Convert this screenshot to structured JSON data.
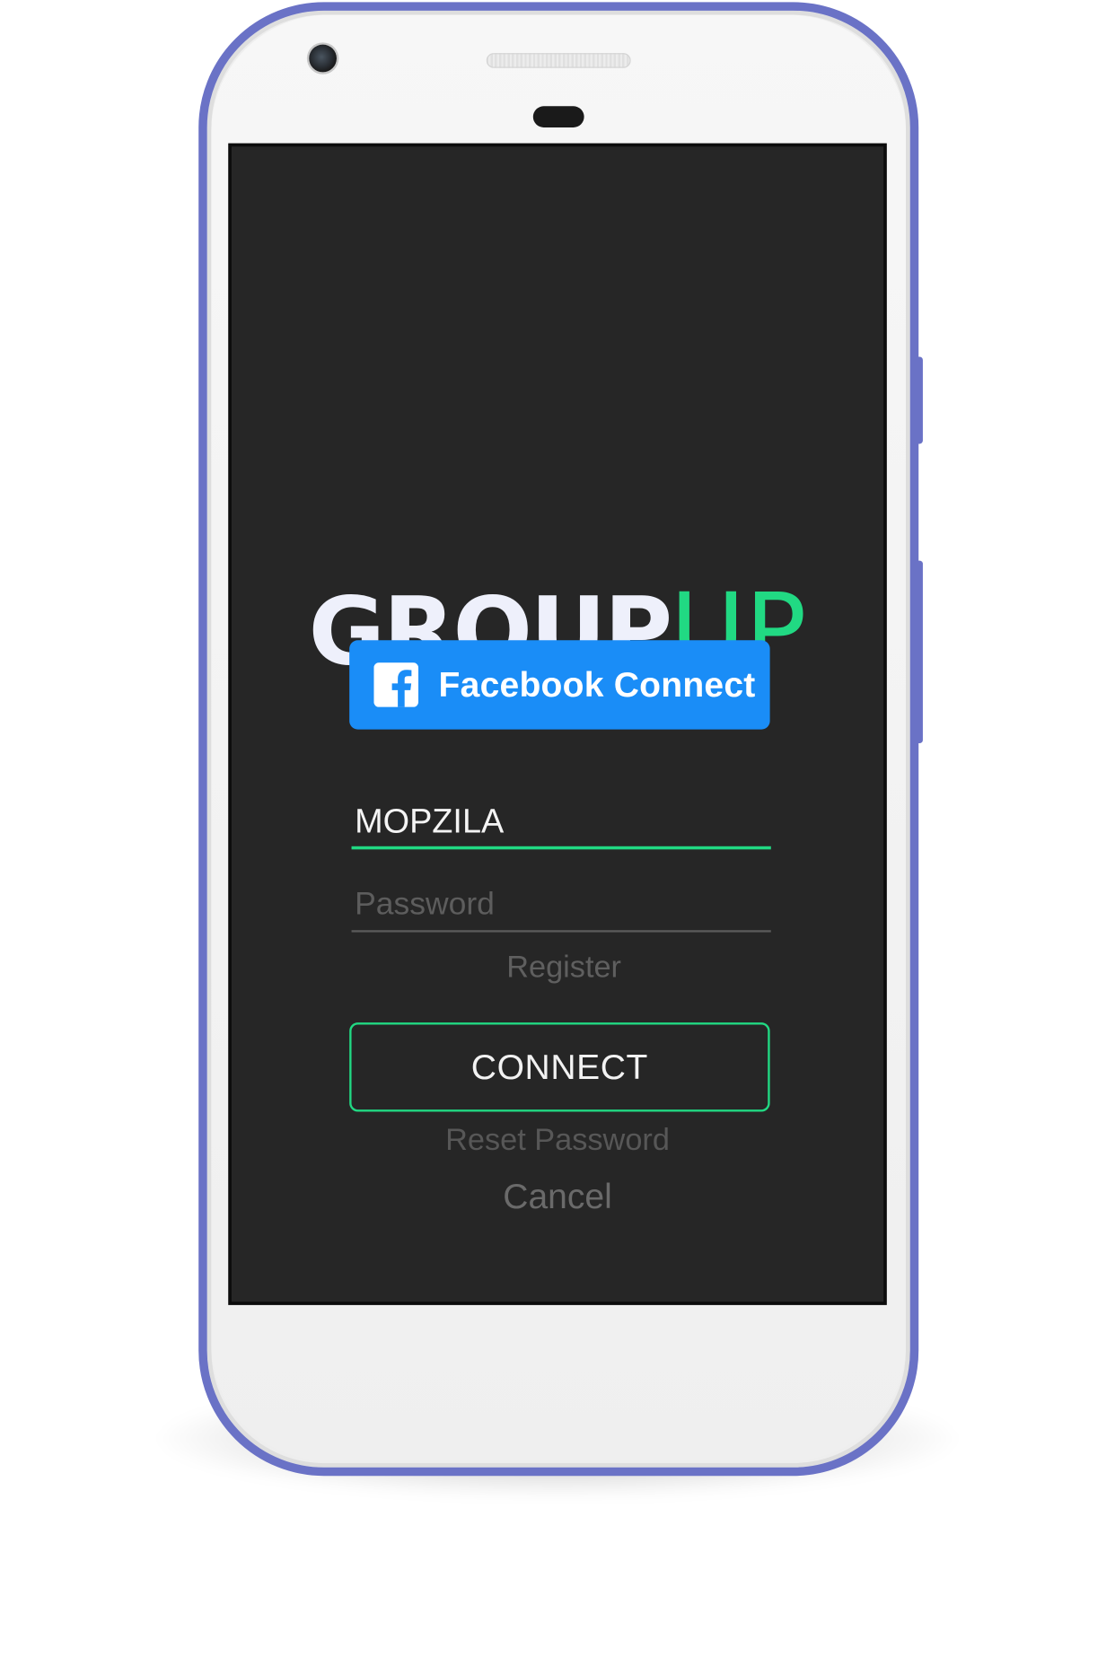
{
  "app": {
    "logo": {
      "bold_part": "GROUP",
      "light_part": "UP"
    }
  },
  "login": {
    "facebook_button_label": "Facebook Connect",
    "username_value": "MOPZILA",
    "password_placeholder": "Password",
    "register_label": "Register",
    "connect_button_label": "CONNECT",
    "reset_password_label": "Reset Password",
    "cancel_label": "Cancel"
  },
  "icons": {
    "facebook": "facebook-icon"
  },
  "colors": {
    "screen_background": "#262626",
    "accent_green": "#21d983",
    "facebook_blue": "#1a8df7",
    "logo_white": "#eef0fb",
    "phone_frame": "#6a72c6"
  }
}
